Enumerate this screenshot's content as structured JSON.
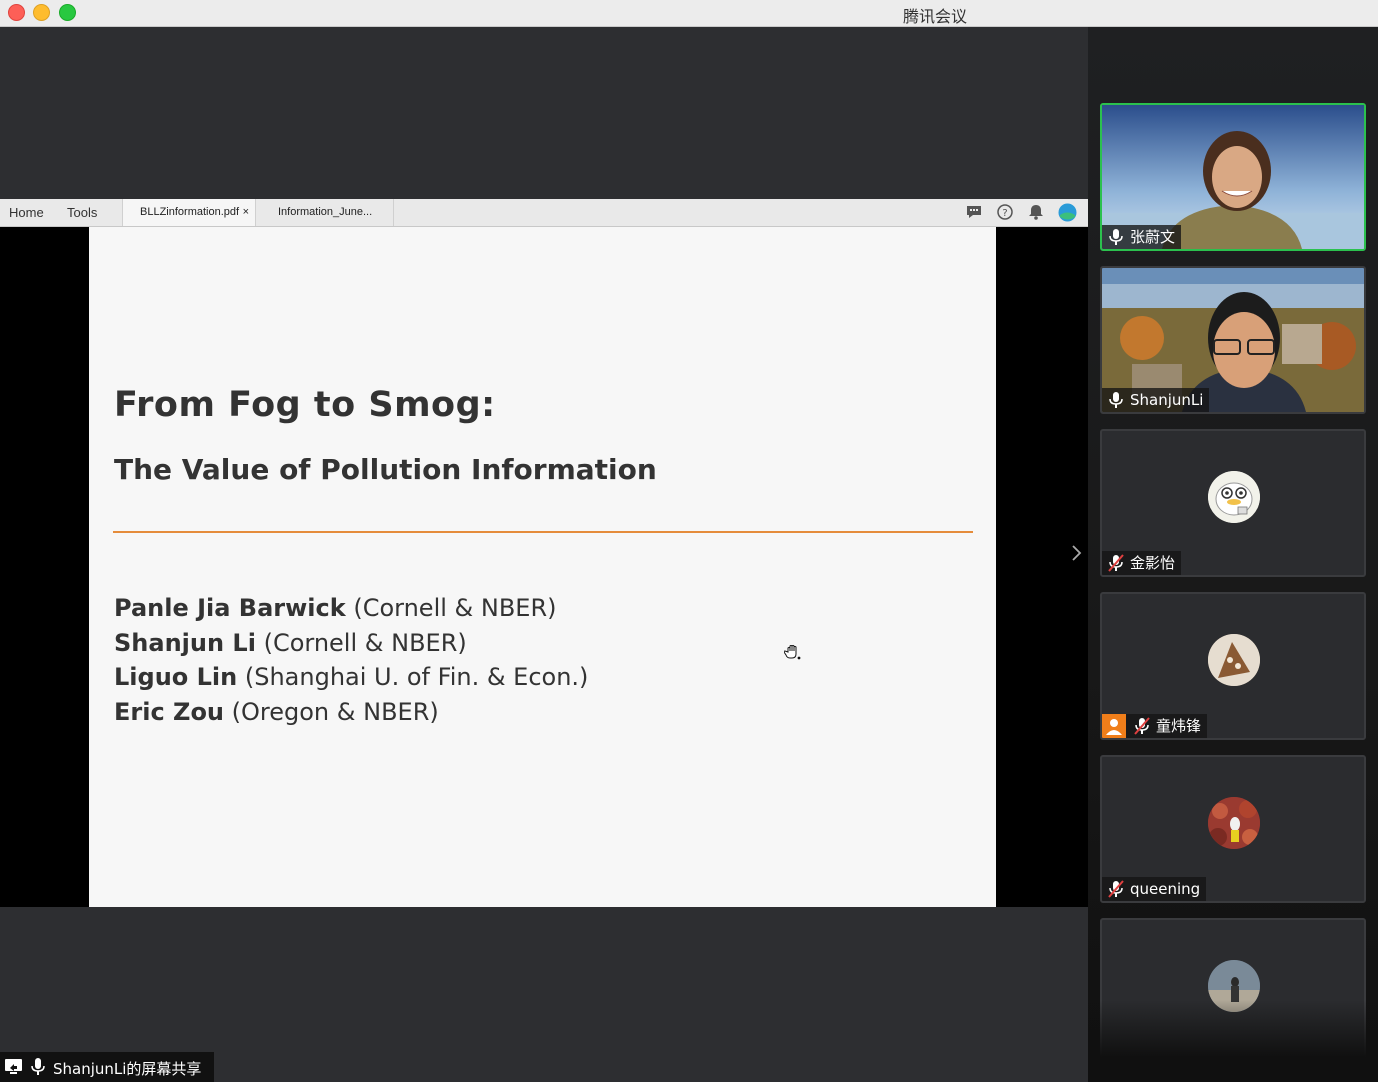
{
  "app": {
    "title": "腾讯会议"
  },
  "acrobat": {
    "home_label": "Home",
    "tools_label": "Tools",
    "tabs": [
      {
        "label": "BLLZinformation.pdf",
        "close": "×"
      },
      {
        "label": "Information_June..."
      }
    ]
  },
  "slide": {
    "title": "From Fog to Smog:",
    "subtitle": "The Value of Pollution Information",
    "authors": [
      {
        "name": "Panle Jia Barwick",
        "affiliation": "(Cornell & NBER)"
      },
      {
        "name": "Shanjun Li",
        "affiliation": "(Cornell & NBER)"
      },
      {
        "name": "Liguo Lin",
        "affiliation": "(Shanghai U. of Fin. & Econ.)"
      },
      {
        "name": "Eric Zou",
        "affiliation": "(Oregon & NBER)"
      }
    ]
  },
  "share_status": {
    "label": "ShanjunLi的屏幕共享"
  },
  "participants": [
    {
      "name": "张蔚文",
      "mic": "on",
      "speaking": true
    },
    {
      "name": "ShanjunLi",
      "mic": "on"
    },
    {
      "name": "金影怡",
      "mic": "muted"
    },
    {
      "name": "童炜锋",
      "mic": "muted",
      "host": true
    },
    {
      "name": "queening",
      "mic": "muted"
    },
    {
      "name": ""
    }
  ],
  "colors": {
    "speaking_border": "#2bc14e",
    "accent_rule": "#e58c3b",
    "muted_mic": "#e04040"
  }
}
